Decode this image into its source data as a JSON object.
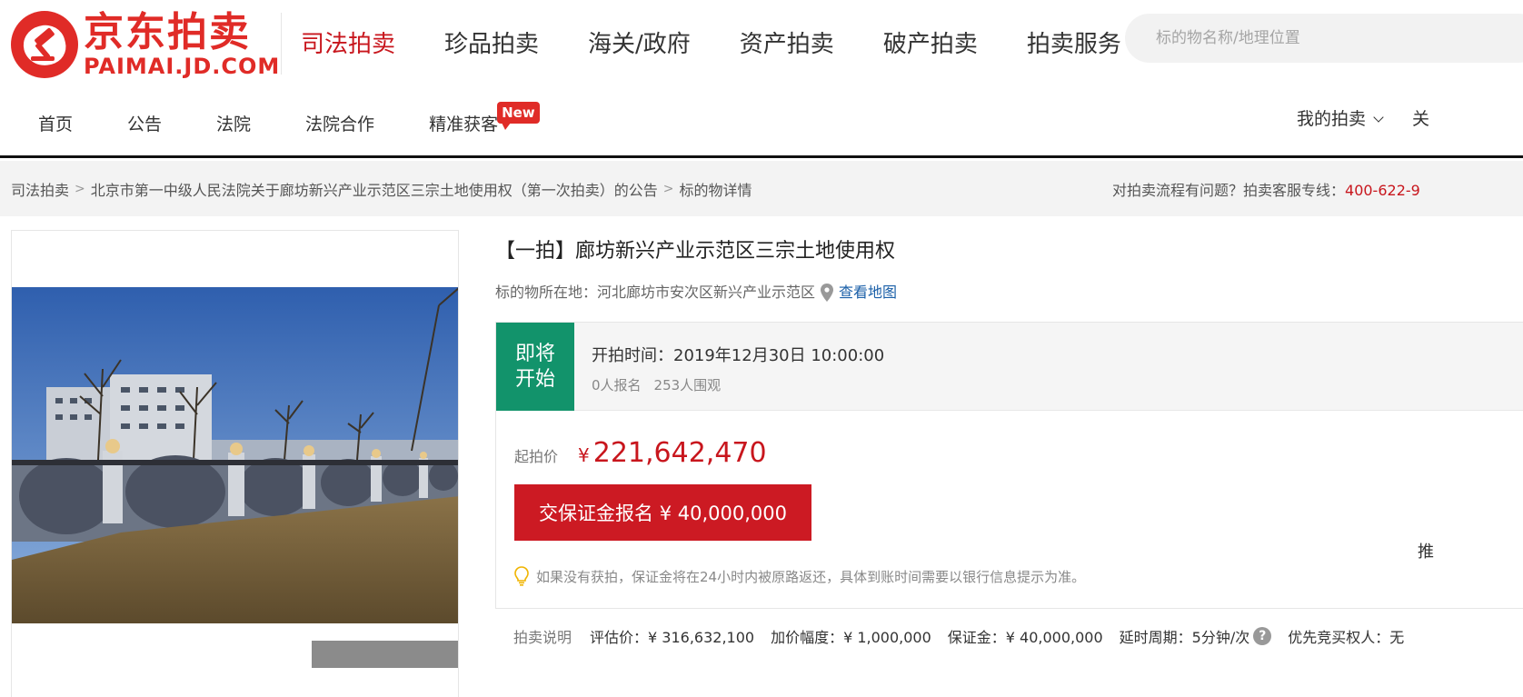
{
  "logo": {
    "cn": "京东拍卖",
    "en": "PAIMAI.JD.COM"
  },
  "main_nav": [
    {
      "label": "司法拍卖",
      "active": true
    },
    {
      "label": "珍品拍卖"
    },
    {
      "label": "海关/政府"
    },
    {
      "label": "资产拍卖"
    },
    {
      "label": "破产拍卖"
    },
    {
      "label": "拍卖服务"
    }
  ],
  "search": {
    "placeholder": "标的物名称/地理位置"
  },
  "sub_nav": [
    {
      "label": "首页"
    },
    {
      "label": "公告"
    },
    {
      "label": "法院"
    },
    {
      "label": "法院合作"
    },
    {
      "label": "精准获客",
      "badge": "New"
    }
  ],
  "user_menu": {
    "my_auction": "我的拍卖",
    "follow": "关"
  },
  "breadcrumb": [
    "司法拍卖",
    "北京市第一中级人民法院关于廊坊新兴产业示范区三宗土地使用权（第一次拍卖）的公告",
    "标的物详情"
  ],
  "help": {
    "text": "对拍卖流程有问题？拍卖客服专线：",
    "phone": "400-622-9"
  },
  "lot": {
    "title": "【一拍】廊坊新兴产业示范区三宗土地使用权",
    "location_label": "标的物所在地：",
    "location": "河北廊坊市安次区新兴产业示范区",
    "map_link": "查看地图"
  },
  "status": {
    "badge": "即将开始",
    "start_time": "开拍时间：2019年12月30日 10:00:00",
    "signups": "0人报名",
    "watchers": "253人围观"
  },
  "price": {
    "label": "起拍价",
    "currency": "¥",
    "value": "221,642,470",
    "deposit_button": "交保证金报名 ¥ 40,000,000",
    "hint": "如果没有获拍，保证金将在24小时内被原路返还，具体到账时间需要以银行信息提示为准。",
    "clipped_char": "推"
  },
  "details": {
    "label": "拍卖说明",
    "appraisal": "评估价：¥ 316,632,100",
    "increment": "加价幅度：¥ 1,000,000",
    "deposit": "保证金：¥ 40,000,000",
    "delay": "延时周期：5分钟/次",
    "priority": "优先竞买权人：无"
  },
  "colors": {
    "brand_red": "#c8161d",
    "status_green": "#12936b",
    "link_blue": "#1a5fa8"
  }
}
